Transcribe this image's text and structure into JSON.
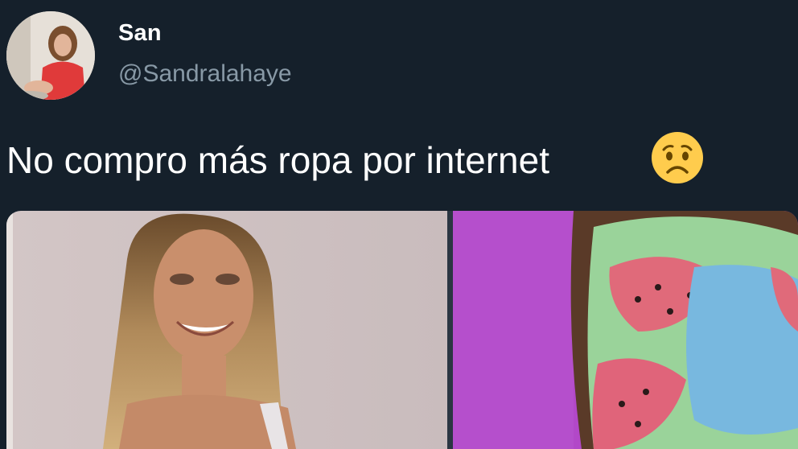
{
  "user": {
    "display_name": "San",
    "handle": "@Sandralahaye",
    "avatar_icon": "profile-photo"
  },
  "tweet": {
    "text": "No compro más ropa por internet",
    "emoji_icon": "worried-face-emoji"
  },
  "media": {
    "left_image": "photo-woman-smiling",
    "right_image": "photo-watermelon-print-clothing"
  },
  "colors": {
    "background": "#15202b",
    "text_primary": "#ffffff",
    "text_secondary": "#8899a6",
    "emoji_yellow": "#ffcc4d"
  }
}
